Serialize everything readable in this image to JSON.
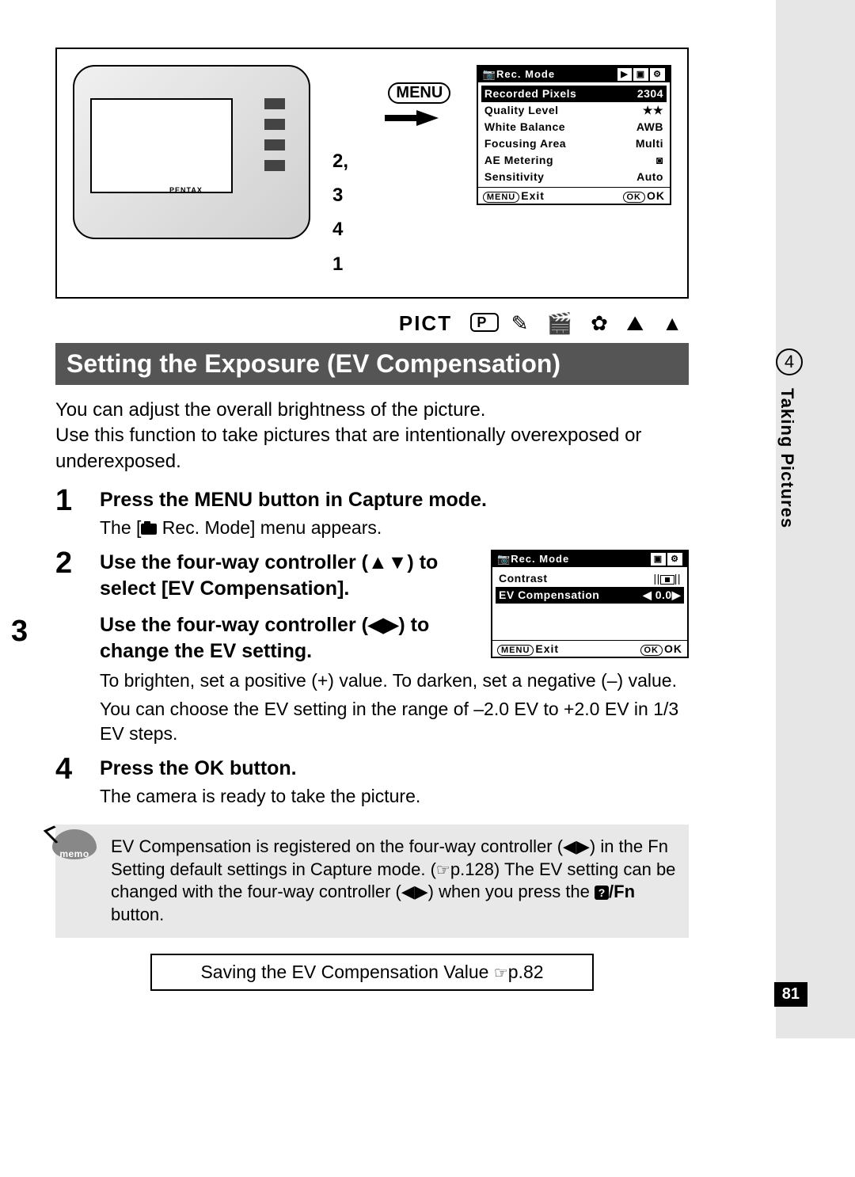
{
  "sidebar": {
    "chapter_num": "4",
    "chapter_title": "Taking Pictures"
  },
  "page_number": "81",
  "diagram": {
    "menu_label": "MENU",
    "step_labels_top": "2, 3",
    "step_label_mid": "4",
    "step_label_bottom": "1",
    "camera_brand": "PENTAX"
  },
  "lcd1": {
    "title": "Rec. Mode",
    "rows": [
      {
        "label": "Recorded Pixels",
        "value": "2304"
      },
      {
        "label": "Quality Level",
        "value": "★★"
      },
      {
        "label": "White Balance",
        "value": "AWB"
      },
      {
        "label": "Focusing Area",
        "value": "Multi"
      },
      {
        "label": "AE Metering",
        "value": "◙"
      },
      {
        "label": "Sensitivity",
        "value": "Auto"
      }
    ],
    "footer_exit_chip": "MENU",
    "footer_exit": "Exit",
    "footer_ok_chip": "OK",
    "footer_ok": "OK"
  },
  "lcd2": {
    "title": "Rec. Mode",
    "rows": [
      {
        "label": "Contrast",
        "value": ""
      },
      {
        "label": "EV Compensation",
        "value": "0.0"
      }
    ],
    "footer_exit_chip": "MENU",
    "footer_exit": "Exit",
    "footer_ok_chip": "OK",
    "footer_ok": "OK"
  },
  "mode_row": {
    "pict": "PICT",
    "p": "P",
    "icons": "✎ ⚘ ❀ ▲ ▲"
  },
  "section_title": "Setting the Exposure (EV Compensation)",
  "intro": "You can adjust the overall brightness of the picture.\nUse this function to take pictures that are intentionally overexposed or underexposed.",
  "steps": [
    {
      "head": "Press the MENU button in Capture mode.",
      "body_prefix": "The [",
      "body_suffix": " Rec. Mode] menu appears."
    },
    {
      "head": "Use the four-way controller (▲▼) to select [EV Compensation]."
    },
    {
      "head": "Use the four-way controller (◀▶) to change the EV setting.",
      "body": "To brighten, set a positive (+) value. To darken, set a negative (–) value.",
      "body2": "You can choose the EV setting in the range of –2.0 EV to +2.0 EV in 1/3 EV steps."
    },
    {
      "head": "Press the OK button.",
      "body": "The camera is ready to take the picture."
    }
  ],
  "memo": {
    "icon_label": "memo",
    "text_a": "EV Compensation is registered on the four-way controller (◀▶) in the Fn Setting default settings in Capture mode. (",
    "text_ref": "p.128",
    "text_b": ") The EV setting can be changed with the four-way controller (◀▶) when you press the ",
    "btn": "/Fn",
    "text_c": " button."
  },
  "ref_box": {
    "text": "Saving the EV Compensation Value ",
    "page": "p.82"
  }
}
